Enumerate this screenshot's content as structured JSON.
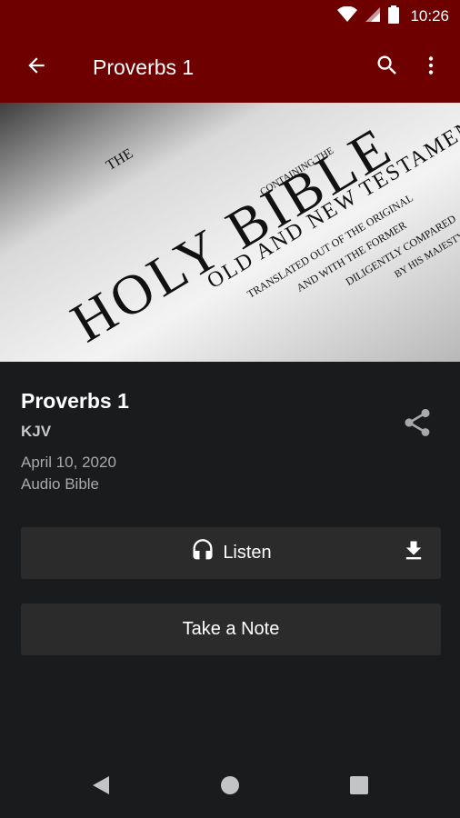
{
  "status_bar": {
    "time": "10:26"
  },
  "toolbar": {
    "title": "Proverbs 1",
    "back_icon": "arrow-back-icon",
    "search_icon": "search-icon",
    "menu_icon": "more-vert-icon"
  },
  "hero": {
    "image": "holy-bible-title-page",
    "lines": [
      "THE",
      "HOLY BIBLE",
      "CONTAINING THE",
      "OLD AND NEW TESTAMENT",
      "TRANSLATED OUT OF THE ORIGINAL",
      "AND WITH THE FORMER",
      "DILIGENTLY COMPARED",
      "BY HIS MAJESTY"
    ]
  },
  "content": {
    "title": "Proverbs 1",
    "version": "KJV",
    "date": "April 10, 2020",
    "category": "Audio Bible"
  },
  "actions": {
    "listen_label": "Listen",
    "note_label": "Take a Note"
  },
  "colors": {
    "appbar": "#6e0000",
    "background": "#1a1b1d",
    "button": "#2b2b2b"
  }
}
